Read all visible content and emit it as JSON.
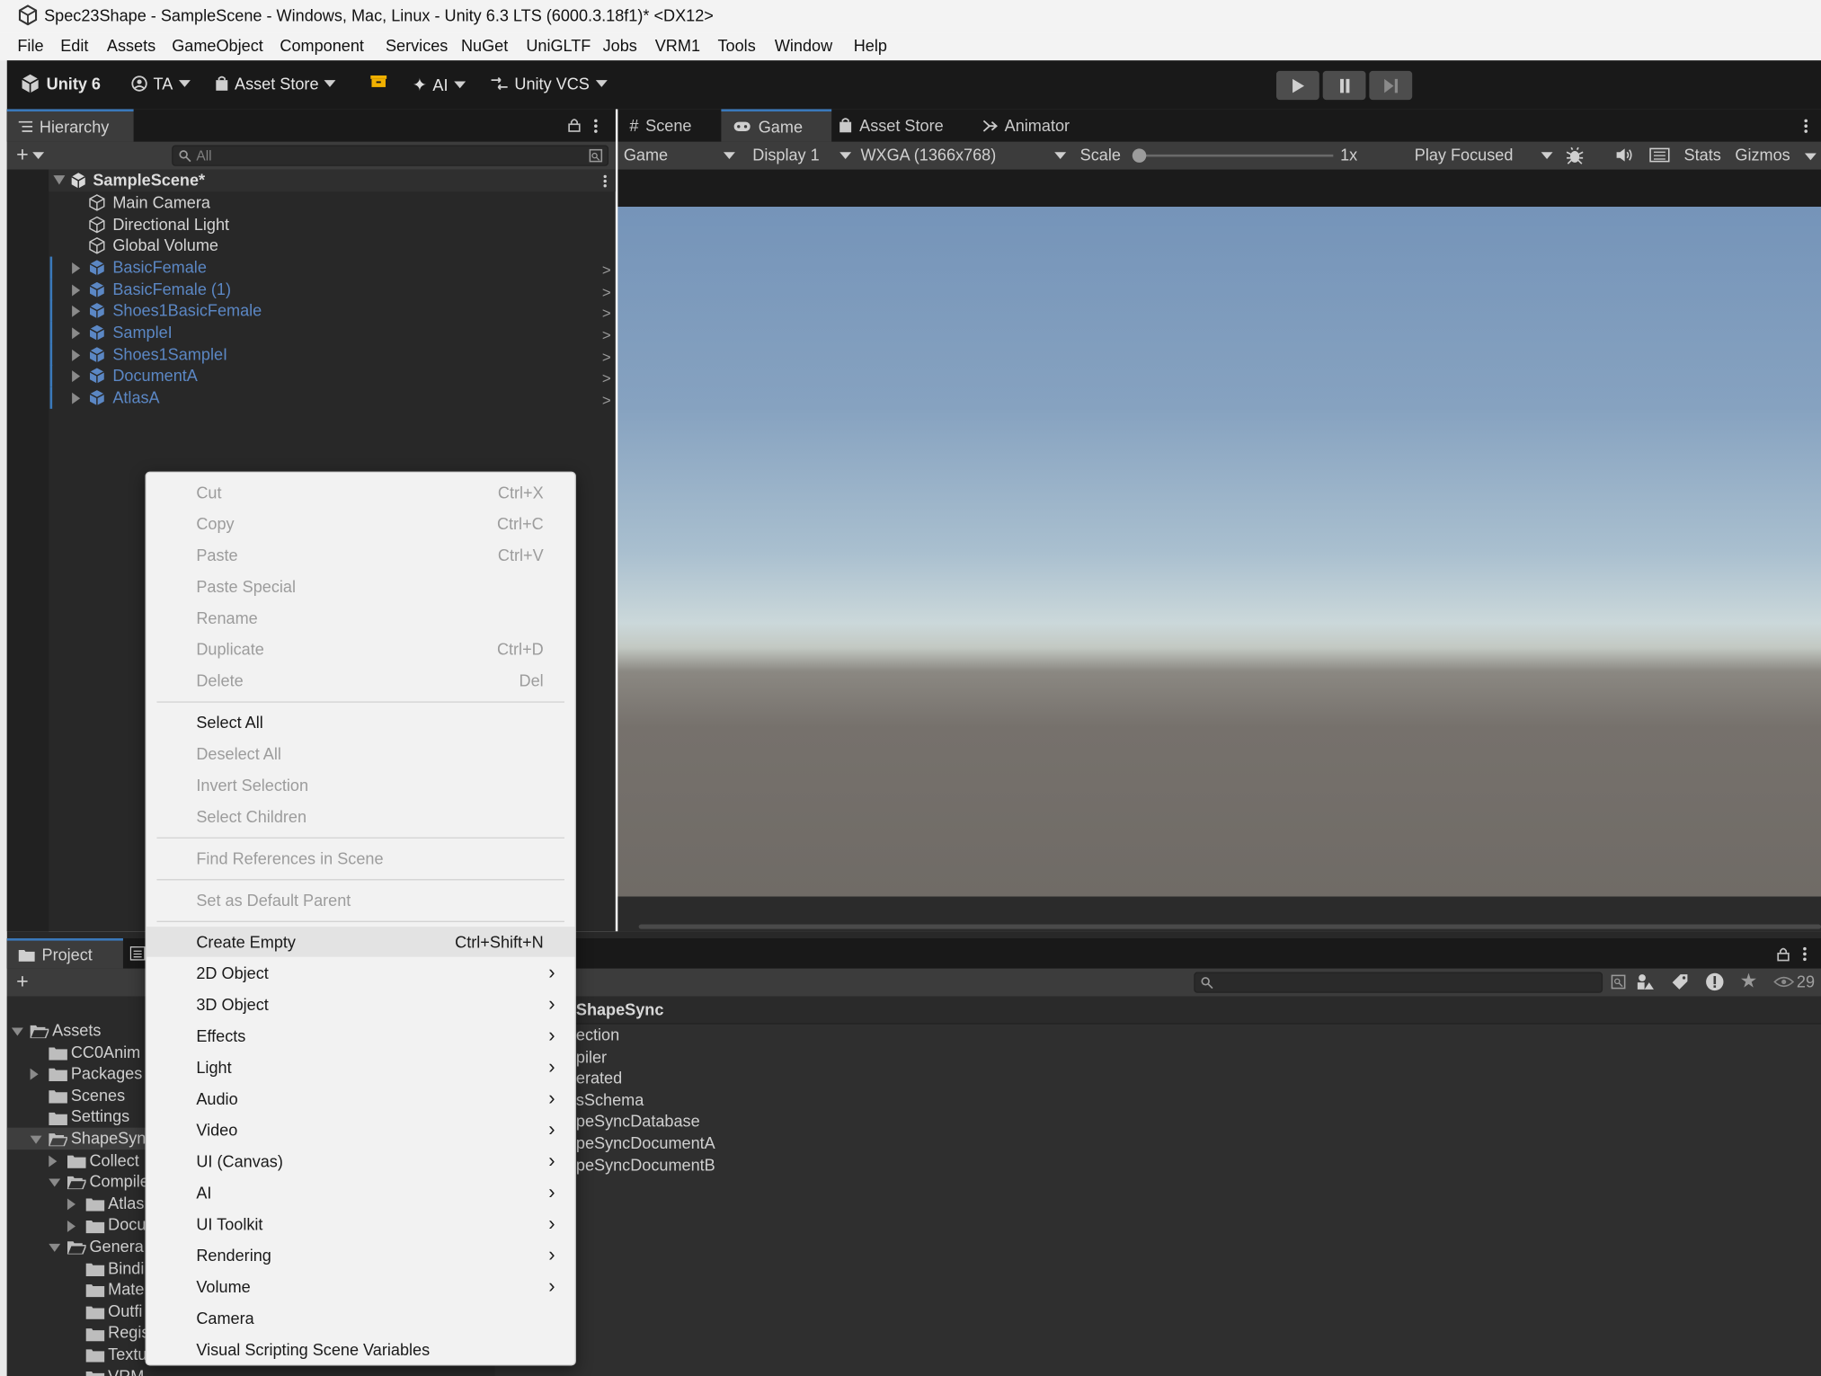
{
  "window": {
    "title": "Spec23Shape - SampleScene - Windows, Mac, Linux - Unity 6.3 LTS (6000.3.18f1)* <DX12>"
  },
  "menu": [
    "File",
    "Edit",
    "Assets",
    "GameObject",
    "Component",
    "Services",
    "NuGet",
    "UniGLTF",
    "Jobs",
    "VRM1",
    "Tools",
    "Window",
    "Help"
  ],
  "toolbar": {
    "unity": "Unity 6",
    "account": "TA",
    "asset_store": "Asset Store",
    "ai": "AI",
    "vcs": "Unity VCS"
  },
  "hierarchy": {
    "tab": "Hierarchy",
    "search_placeholder": "All",
    "scene": "SampleScene*",
    "plain_items": [
      "Main Camera",
      "Directional Light",
      "Global Volume"
    ],
    "prefab_items": [
      "BasicFemale",
      "BasicFemale (1)",
      "Shoes1BasicFemale",
      "SampleI",
      "Shoes1SampleI",
      "DocumentA",
      "AtlasA"
    ]
  },
  "game": {
    "tabs": [
      "Scene",
      "Game",
      "Asset Store",
      "Animator"
    ],
    "active_tab": "Game",
    "view": "Game",
    "display": "Display 1",
    "resolution": "WXGA (1366x768)",
    "scale_label": "Scale",
    "scale_value": "1x",
    "play_mode": "Play Focused",
    "stats": "Stats",
    "gizmos": "Gizmos"
  },
  "project": {
    "tab": "Project",
    "breadcrumb": "ShapeSync",
    "hidden_count": "29",
    "tree": [
      {
        "label": "Assets",
        "indent": 0,
        "state": "open"
      },
      {
        "label": "CC0Anim",
        "indent": 1,
        "state": "none"
      },
      {
        "label": "Packages",
        "indent": 1,
        "state": "closed"
      },
      {
        "label": "Scenes",
        "indent": 1,
        "state": "none"
      },
      {
        "label": "Settings",
        "indent": 1,
        "state": "none"
      },
      {
        "label": "ShapeSyn",
        "indent": 1,
        "state": "open"
      },
      {
        "label": "Collect",
        "indent": 2,
        "state": "closed"
      },
      {
        "label": "Compile",
        "indent": 2,
        "state": "open"
      },
      {
        "label": "Atlas",
        "indent": 3,
        "state": "closed"
      },
      {
        "label": "Docu",
        "indent": 3,
        "state": "closed"
      },
      {
        "label": "Genera",
        "indent": 2,
        "state": "open"
      },
      {
        "label": "Bindi",
        "indent": 3,
        "state": "none"
      },
      {
        "label": "Mate",
        "indent": 3,
        "state": "none"
      },
      {
        "label": "Outfi",
        "indent": 3,
        "state": "none"
      },
      {
        "label": "Regis",
        "indent": 3,
        "state": "none"
      },
      {
        "label": "Textu",
        "indent": 3,
        "state": "none"
      },
      {
        "label": "VRM",
        "indent": 3,
        "state": "none"
      }
    ],
    "contents": [
      "ection",
      "piler",
      "erated",
      "sSchema",
      "peSyncDatabase",
      "peSyncDocumentA",
      "peSyncDocumentB"
    ]
  },
  "context_menu": [
    {
      "label": "Cut",
      "shortcut": "Ctrl+X",
      "disabled": true
    },
    {
      "label": "Copy",
      "shortcut": "Ctrl+C",
      "disabled": true
    },
    {
      "label": "Paste",
      "shortcut": "Ctrl+V",
      "disabled": true
    },
    {
      "label": "Paste Special",
      "shortcut": "",
      "disabled": true
    },
    {
      "label": "Rename",
      "shortcut": "",
      "disabled": true
    },
    {
      "label": "Duplicate",
      "shortcut": "Ctrl+D",
      "disabled": true
    },
    {
      "label": "Delete",
      "shortcut": "Del",
      "disabled": true
    },
    {
      "separator": true
    },
    {
      "label": "Select All",
      "shortcut": "",
      "disabled": false
    },
    {
      "label": "Deselect All",
      "shortcut": "",
      "disabled": true
    },
    {
      "label": "Invert Selection",
      "shortcut": "",
      "disabled": true
    },
    {
      "label": "Select Children",
      "shortcut": "",
      "disabled": true
    },
    {
      "separator": true
    },
    {
      "label": "Find References in Scene",
      "shortcut": "",
      "disabled": true
    },
    {
      "separator": true
    },
    {
      "label": "Set as Default Parent",
      "shortcut": "",
      "disabled": true
    },
    {
      "separator": true
    },
    {
      "label": "Create Empty",
      "shortcut": "Ctrl+Shift+N",
      "disabled": false,
      "hover": true
    },
    {
      "label": "2D Object",
      "submenu": true
    },
    {
      "label": "3D Object",
      "submenu": true
    },
    {
      "label": "Effects",
      "submenu": true
    },
    {
      "label": "Light",
      "submenu": true
    },
    {
      "label": "Audio",
      "submenu": true
    },
    {
      "label": "Video",
      "submenu": true
    },
    {
      "label": "UI (Canvas)",
      "submenu": true
    },
    {
      "label": "AI",
      "submenu": true
    },
    {
      "label": "UI Toolkit",
      "submenu": true
    },
    {
      "label": "Rendering",
      "submenu": true
    },
    {
      "label": "Volume",
      "submenu": true
    },
    {
      "label": "Camera",
      "submenu": false
    },
    {
      "label": "Visual Scripting Scene Variables",
      "submenu": false
    }
  ],
  "colors": {
    "accent": "#3a79bb",
    "prefab_text": "#5b87c4",
    "panel": "#282828",
    "toolbar": "#191919",
    "menu_bg": "#f2f2f2"
  }
}
